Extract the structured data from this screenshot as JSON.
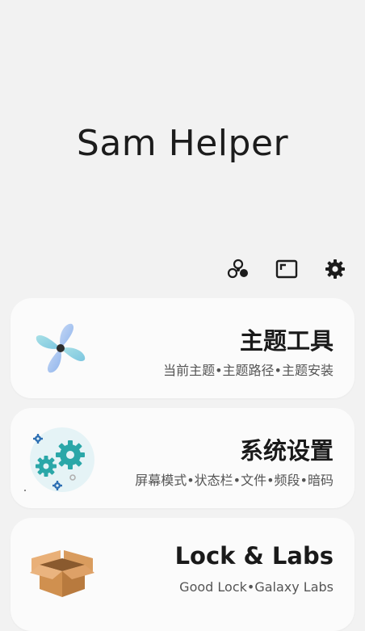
{
  "app": {
    "title": "Sam Helper"
  },
  "toolbar": {
    "icons": [
      "fan-network-icon",
      "window-frame-icon",
      "settings-gear-icon"
    ]
  },
  "cards": [
    {
      "title": "主题工具",
      "subtitle": "当前主题•主题路径•主题安装",
      "icon": "pinwheel-fan-icon"
    },
    {
      "title": "系统设置",
      "subtitle": "屏幕模式•状态栏•文件•频段•暗码",
      "icon": "gears-icon"
    },
    {
      "title": "Lock & Labs",
      "subtitle": "Good Lock•Galaxy Labs",
      "icon": "cardboard-box-icon"
    }
  ],
  "colors": {
    "background": "#f2f2f2",
    "card": "#fbfbfb",
    "gear_teal": "#2aa7a8",
    "gear_blue": "#2d6fb3",
    "fan_blue": "#9fc3f0",
    "box_brown": "#c8894f"
  }
}
